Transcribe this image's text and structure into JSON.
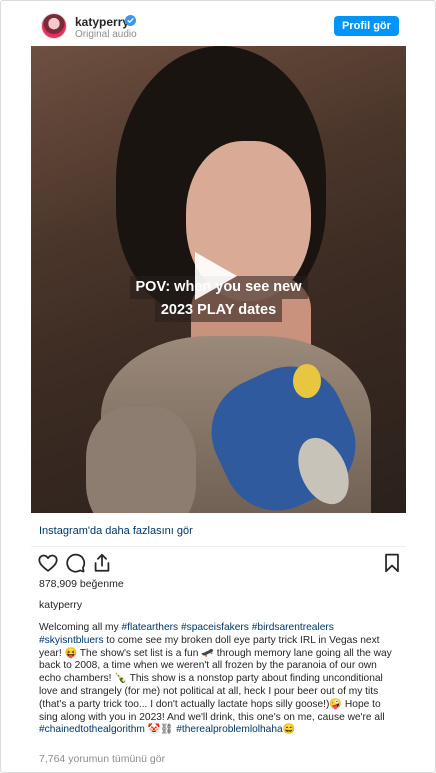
{
  "header": {
    "username": "katyperry",
    "subtitle": "Original audio",
    "profile_button": "Profil gör",
    "accent": "#0095f6"
  },
  "media": {
    "overlay_line1": "POV: when you see new",
    "overlay_line2": "2023 PLAY dates",
    "play_icon": "play-icon"
  },
  "more_link": "Instagram'da daha fazlasını gör",
  "actions": {
    "like_icon": "heart-icon",
    "comment_icon": "comment-icon",
    "share_icon": "share-icon",
    "save_icon": "bookmark-icon"
  },
  "likes": "878,909 beğenme",
  "poster": "katyperry",
  "caption": {
    "p1": "Welcoming all my ",
    "t1": "#flatearthers",
    "s1": " ",
    "t2": "#spaceisfakers",
    "s2": " ",
    "t3": "#birdsarentrealers",
    "s3": " ",
    "t4": "#skyisntbluers",
    "p2": " to come see my broken doll eye party trick IRL in Vegas next year! 😝 The show's set list is a fun 🛹 through memory lane going all the way back to 2008, a time when we weren't all frozen by the paranoia of our own echo chambers! 🍾 This show is a nonstop party about finding unconditional love and strangely (for me) not political at all, heck I pour beer out of my tits (that's a party trick too... I don't actually lactate hops silly goose!)🤪 Hope to sing along with you in 2023! And we'll drink, this one's on me, cause we're all ",
    "t5": "#chainedtothealgorithm",
    "p3": " 🤡⛓ ",
    "t6": "#therealproblemlolhaha",
    "p4": "😄"
  },
  "all_comments": "7,764 yorumun tümünü gör"
}
